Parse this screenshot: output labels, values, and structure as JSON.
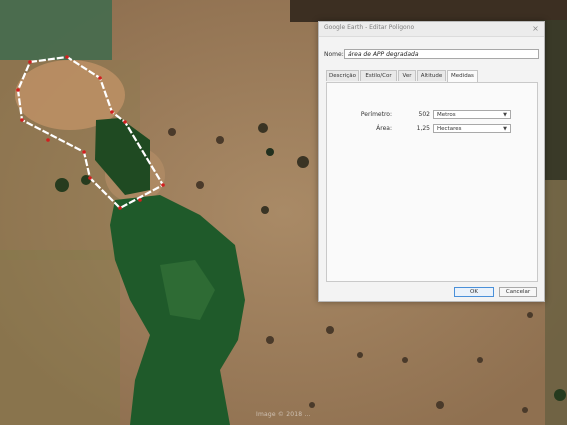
{
  "dialog": {
    "title": "Google Earth - Editar Polígono",
    "close_glyph": "×",
    "name_label": "Nome:",
    "name_value": "área de APP degradada",
    "tabs": [
      {
        "label": "Descrição"
      },
      {
        "label": "Estilo/Cor"
      },
      {
        "label": "Ver"
      },
      {
        "label": "Altitude"
      },
      {
        "label": "Medidas"
      }
    ],
    "active_tab": "Medidas",
    "measures": {
      "perimeter_label": "Perímetro:",
      "perimeter_value": "502",
      "perimeter_unit": "Metros",
      "area_label": "Área:",
      "area_value": "1,25",
      "area_unit": "Hectares"
    },
    "ok_label": "OK",
    "cancel_label": "Cancelar"
  },
  "map": {
    "watermark": "Image © 2018 ..."
  },
  "colors": {
    "pasture": "#9b7b57",
    "forest": "#1f5a2a",
    "polygon_line": "#ffffff",
    "polygon_vertex": "#d21f1f"
  }
}
